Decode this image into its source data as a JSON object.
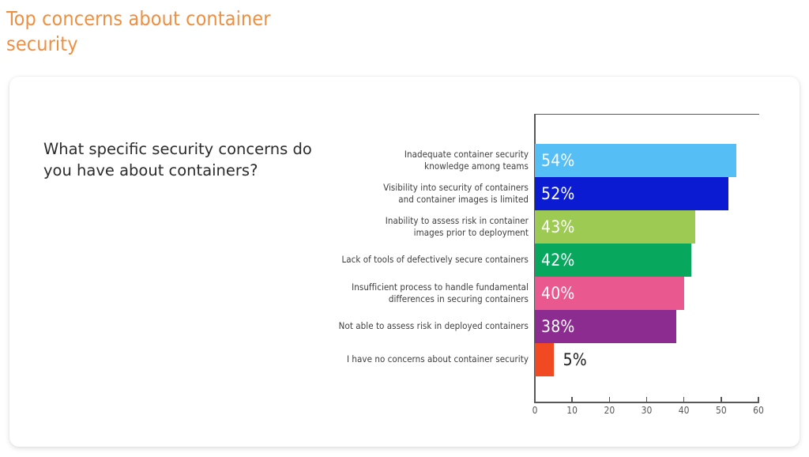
{
  "slide": {
    "title": "Top concerns about container security",
    "title_color": "#ED9042"
  },
  "card": {
    "question": "What specific security concerns do you have about containers?"
  },
  "chart_data": {
    "type": "bar",
    "orientation": "horizontal",
    "title": "Top concerns about container security",
    "xlabel": "",
    "ylabel": "",
    "xlim": [
      0,
      60
    ],
    "xticks": [
      "0",
      "10",
      "20",
      "30",
      "40",
      "50",
      "60"
    ],
    "grid": false,
    "legend": "none",
    "value_suffix": "%",
    "categories": [
      "Inadequate container security knowledge among teams",
      "Visibility into security of containers and container images is limited",
      "Inability to assess risk in container images prior to deployment",
      "Lack of tools of defectively secure containers",
      "Insufficient process to handle fundamental differences in securing containers",
      "Not able to assess risk in deployed containers",
      "I have no concerns about container security"
    ],
    "category_lines": [
      [
        "Inadequate container security",
        "knowledge among teams"
      ],
      [
        "Visibility into security of containers",
        "and container images is limited"
      ],
      [
        "Inability to assess risk in container",
        "images prior to deployment"
      ],
      [
        "Lack of tools of defectively secure containers"
      ],
      [
        "Insufficient process to handle fundamental",
        "differences in securing containers"
      ],
      [
        "Not able to assess risk in deployed containers"
      ],
      [
        "I have no concerns about container security"
      ]
    ],
    "values": [
      54,
      52,
      43,
      42,
      40,
      38,
      5
    ],
    "value_labels": [
      "54%",
      "52%",
      "43%",
      "42%",
      "40%",
      "38%",
      "5%"
    ],
    "colors": [
      "#55BEF4",
      "#0A1BD2",
      "#9CCA53",
      "#07A75E",
      "#E9588F",
      "#8C2C91",
      "#F14A22"
    ],
    "label_placement": [
      "inside",
      "inside",
      "inside",
      "inside",
      "inside",
      "inside",
      "outside"
    ]
  },
  "axis": {
    "tick_color": "#58585a"
  }
}
